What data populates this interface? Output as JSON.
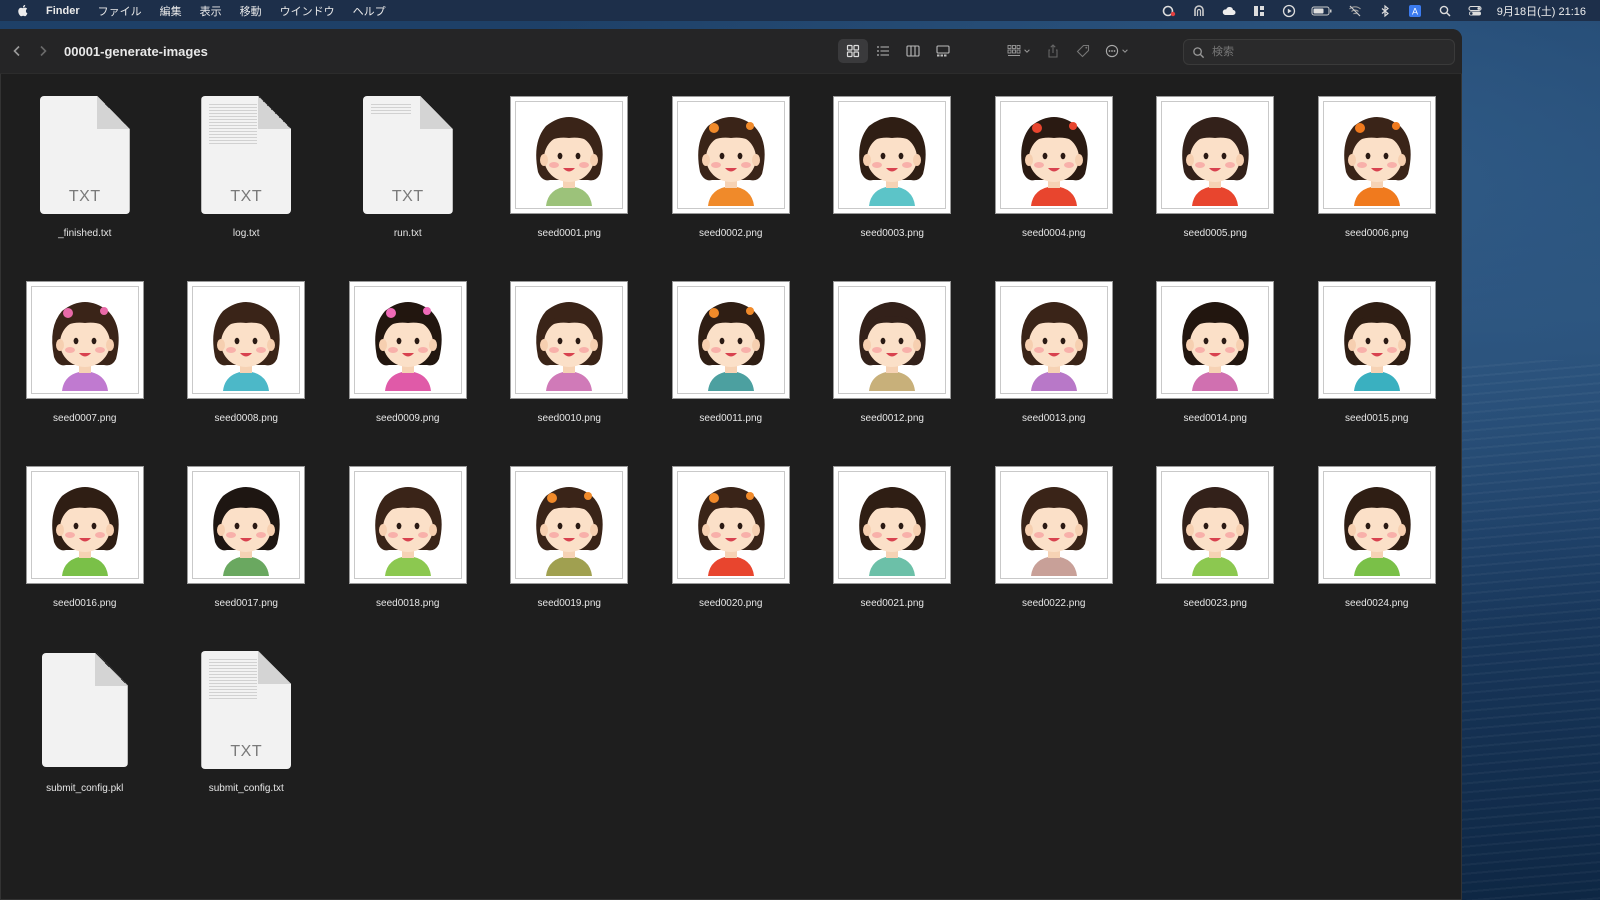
{
  "menubar": {
    "app_name": "Finder",
    "menus": [
      "ファイル",
      "編集",
      "表示",
      "移動",
      "ウインドウ",
      "ヘルプ"
    ],
    "status_icons": [
      "creative-cloud-icon",
      "vpn-icon",
      "cloud-icon",
      "grid-app-icon",
      "play-icon",
      "battery-icon",
      "wifi-off-icon",
      "bluetooth-icon",
      "input-method-icon",
      "spotlight-icon",
      "control-center-icon"
    ],
    "input_method_letter": "A",
    "clock": "9月18日(土)  21:16"
  },
  "window": {
    "title": "00001-generate-images",
    "search_placeholder": "検索"
  },
  "files": [
    {
      "name": "_finished.txt",
      "kind": "txt",
      "ext": "TXT",
      "lines": false
    },
    {
      "name": "log.txt",
      "kind": "txt",
      "ext": "TXT",
      "lines": true
    },
    {
      "name": "run.txt",
      "kind": "txt",
      "ext": "TXT",
      "lines": "short"
    },
    {
      "name": "seed0001.png",
      "kind": "png",
      "hair": "#3a2418",
      "shirt": "#9cc27a",
      "acc": null
    },
    {
      "name": "seed0002.png",
      "kind": "png",
      "hair": "#3a2418",
      "shirt": "#f08a2a",
      "acc": "#f08a2a"
    },
    {
      "name": "seed0003.png",
      "kind": "png",
      "hair": "#2f1e14",
      "shirt": "#5cc4c8",
      "acc": null
    },
    {
      "name": "seed0004.png",
      "kind": "png",
      "hair": "#2a1a12",
      "shirt": "#e8452e",
      "acc": "#e8452e"
    },
    {
      "name": "seed0005.png",
      "kind": "png",
      "hair": "#33211a",
      "shirt": "#e8452e",
      "acc": null
    },
    {
      "name": "seed0006.png",
      "kind": "png",
      "hair": "#3a2418",
      "shirt": "#f07a1e",
      "acc": "#f07a1e"
    },
    {
      "name": "seed0007.png",
      "kind": "png",
      "hair": "#3a2418",
      "shirt": "#c07ad0",
      "acc": "#e86aa8"
    },
    {
      "name": "seed0008.png",
      "kind": "png",
      "hair": "#3a2418",
      "shirt": "#4cb8c8",
      "acc": null
    },
    {
      "name": "seed0009.png",
      "kind": "png",
      "hair": "#22160f",
      "shirt": "#e05aa8",
      "acc": "#f06ab8"
    },
    {
      "name": "seed0010.png",
      "kind": "png",
      "hair": "#3a2418",
      "shirt": "#d07ab8",
      "acc": null
    },
    {
      "name": "seed0011.png",
      "kind": "png",
      "hair": "#2f1e14",
      "shirt": "#4ca0a0",
      "acc": "#f08a2a"
    },
    {
      "name": "seed0012.png",
      "kind": "png",
      "hair": "#33211a",
      "shirt": "#c8b07a",
      "acc": null
    },
    {
      "name": "seed0013.png",
      "kind": "png",
      "hair": "#3a2418",
      "shirt": "#b878c8",
      "acc": null
    },
    {
      "name": "seed0014.png",
      "kind": "png",
      "hair": "#22160f",
      "shirt": "#d070b0",
      "acc": null
    },
    {
      "name": "seed0015.png",
      "kind": "png",
      "hair": "#2f1e14",
      "shirt": "#3ab0c0",
      "acc": null
    },
    {
      "name": "seed0016.png",
      "kind": "png",
      "hair": "#2f1e14",
      "shirt": "#7ac048",
      "acc": null
    },
    {
      "name": "seed0017.png",
      "kind": "png",
      "hair": "#1e1612",
      "shirt": "#6aa860",
      "acc": null
    },
    {
      "name": "seed0018.png",
      "kind": "png",
      "hair": "#3a2418",
      "shirt": "#8cc850",
      "acc": null
    },
    {
      "name": "seed0019.png",
      "kind": "png",
      "hair": "#3a2418",
      "shirt": "#a0a050",
      "acc": "#f08a2a"
    },
    {
      "name": "seed0020.png",
      "kind": "png",
      "hair": "#3a2418",
      "shirt": "#e8452e",
      "acc": "#f08a2a"
    },
    {
      "name": "seed0021.png",
      "kind": "png",
      "hair": "#2f1e14",
      "shirt": "#6cc0a8",
      "acc": null
    },
    {
      "name": "seed0022.png",
      "kind": "png",
      "hair": "#3a2418",
      "shirt": "#c8a098",
      "acc": null
    },
    {
      "name": "seed0023.png",
      "kind": "png",
      "hair": "#33211a",
      "shirt": "#8cc850",
      "acc": null
    },
    {
      "name": "seed0024.png",
      "kind": "png",
      "hair": "#2f1e14",
      "shirt": "#7ac048",
      "acc": null
    },
    {
      "name": "submit_config.pkl",
      "kind": "blank",
      "ext": "",
      "lines": false
    },
    {
      "name": "submit_config.txt",
      "kind": "txt",
      "ext": "TXT",
      "lines": true
    }
  ]
}
